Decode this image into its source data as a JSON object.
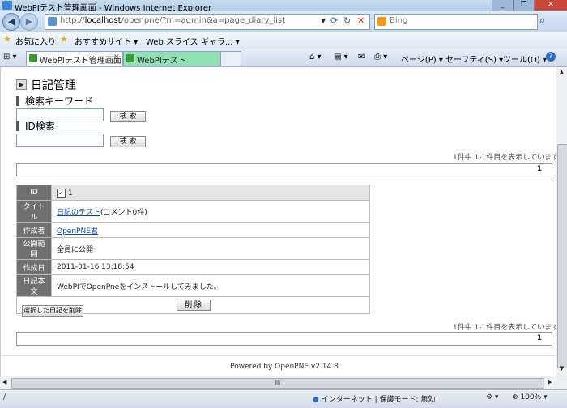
{
  "window": {
    "title": "WebPIテスト管理画面 - Windows Internet Explorer"
  },
  "address_bar": {
    "url_prefix": "http://",
    "url_host": "localhost",
    "url_path": "/openpne/?m=admin&a=page_diary_list",
    "search_placeholder": "Bing"
  },
  "favorites_bar": {
    "favorites_label": "お気に入り",
    "suggested_sites_label": "おすすめサイト",
    "web_slice_label": "Web スライス ギャラ..."
  },
  "tabs": [
    {
      "label": "WebPIテスト管理画面",
      "active": true
    },
    {
      "label": "WebPIテスト",
      "active": false
    }
  ],
  "command_bar": {
    "page_label": "ページ(P)",
    "safety_label": "セーフティ(S)",
    "tools_label": "ツール(O)",
    "help_label": "?"
  },
  "page": {
    "title": "日記管理",
    "keyword_section": "検索キーワード",
    "id_section": "ID検索",
    "search_button": "検 索",
    "pager_text": "1件中 1-1件目を表示しています",
    "page_number": "1",
    "detail": {
      "rows": [
        {
          "label": "ID",
          "value": "1"
        },
        {
          "label": "タイトル",
          "link": "日記のテスト",
          "extra": "(コメント0件)"
        },
        {
          "label": "作成者",
          "link": "OpenPNE君"
        },
        {
          "label": "公開範囲",
          "value": "全員に公開"
        },
        {
          "label": "作成日",
          "value": "2011-01-16 13:18:54"
        },
        {
          "label": "日記本文",
          "value": "WebPIでOpenPneをインストールしてみました。"
        }
      ],
      "delete_button": "削 除"
    },
    "bulk_delete_button": "選択した日記を削除",
    "footer": "Powered by OpenPNE v2.14.8"
  },
  "status_bar": {
    "left_text": "/",
    "zone_text": "インターネット | 保護モード: 無効",
    "zoom": "100%"
  },
  "hscroll_label": "III"
}
